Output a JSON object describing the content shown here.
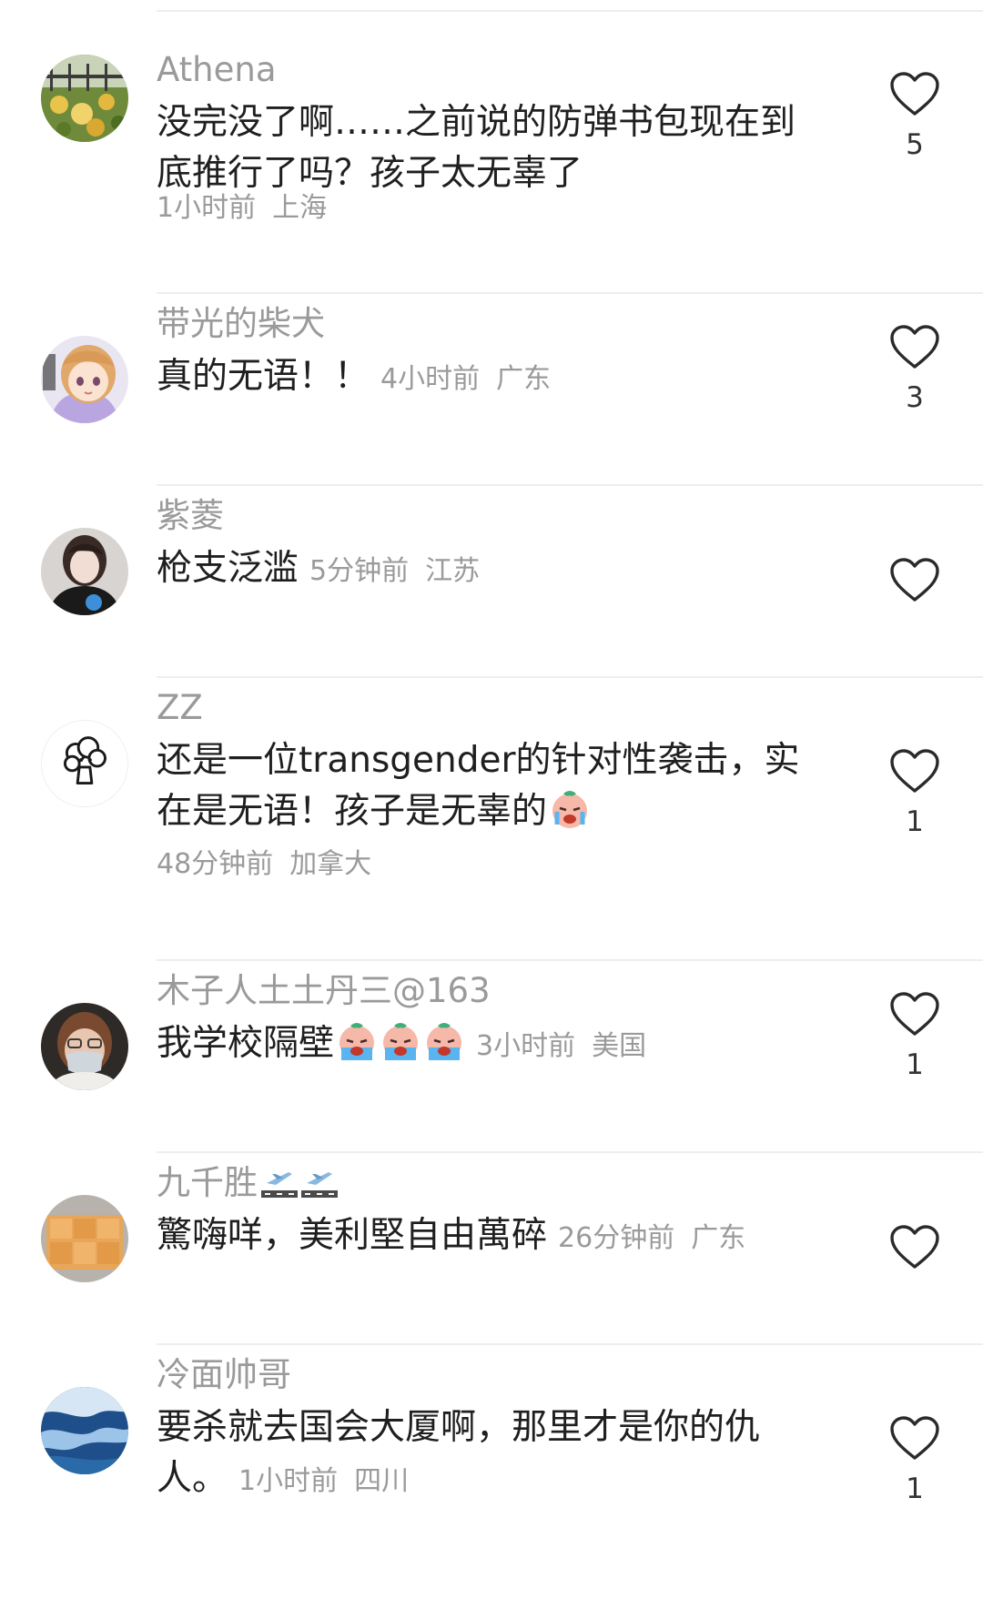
{
  "comments": [
    {
      "username": "Athena",
      "text": "没完没了啊……之前说的防弹书包现在到底推行了吗？孩子太无辜了",
      "time": "1小时前",
      "location": "上海",
      "likes": "5",
      "avatar_icon": "avatar-flowers"
    },
    {
      "username": "带光的柴犬",
      "text": "真的无语！！",
      "time": "4小时前",
      "location": "广东",
      "likes": "3",
      "avatar_icon": "avatar-anime-girl"
    },
    {
      "username": "紫菱",
      "text": "枪支泛滥",
      "time": "5分钟前",
      "location": "江苏",
      "likes": "",
      "avatar_icon": "avatar-girl-photo"
    },
    {
      "username": "ZZ",
      "text": "还是一位transgender的针对性袭击，实在是无语！孩子是无辜的",
      "time": "48分钟前",
      "location": "加拿大",
      "likes": "1",
      "avatar_icon": "avatar-broccoli"
    },
    {
      "username": "木子人土土丹三@163",
      "text": "我学校隔壁",
      "time": "3小时前",
      "location": "美国",
      "likes": "1",
      "avatar_icon": "avatar-masked-person"
    },
    {
      "username": "九千胜",
      "text": "驚嗨咩，美利堅自由萬碎",
      "time": "26分钟前",
      "location": "广东",
      "likes": "",
      "avatar_icon": "avatar-food-tray"
    },
    {
      "username": "冷面帅哥",
      "text": "要杀就去国会大厦啊，那里才是你的仇人。",
      "time": "1小时前",
      "location": "四川",
      "likes": "1",
      "avatar_icon": "avatar-ocean-wave"
    }
  ],
  "colors": {
    "username": "#9a9a9a",
    "text": "#1f1f1f",
    "meta": "#9a9a9a",
    "divider": "#eeeeee",
    "heart": "#2a2a2a"
  }
}
